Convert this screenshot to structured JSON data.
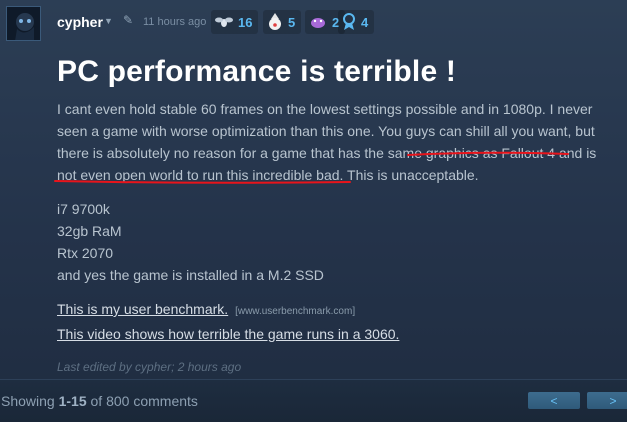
{
  "post": {
    "author": "cypher",
    "timestamp": "11 hours ago",
    "awards": [
      {
        "icon": "fly-icon",
        "count": "16"
      },
      {
        "icon": "clown-icon",
        "count": "5"
      },
      {
        "icon": "purple-crab-icon",
        "count": "2"
      },
      {
        "icon": "ribbon-icon",
        "count": "4"
      }
    ],
    "title": "PC performance is terrible !",
    "paragraph": "I cant even hold stable 60 frames on the lowest settings possible and in 1080p. I never seen a game with worse optimization than this one. You guys can shill all you want, but there is absolutely no reason for a game that has the same graphics as Fallout 4 and is not even open world to run this incredible bad. This is unacceptable.",
    "specs": [
      "i7 9700k",
      "32gb RaM",
      "Rtx 2070",
      "and yes the game is installed in a M.2 SSD"
    ],
    "links": [
      {
        "text": "This is my user benchmark.",
        "host": "[www.userbenchmark.com]"
      },
      {
        "text": "This video shows how terrible the game runs in a 3060."
      }
    ],
    "edited": "Last edited by cypher; 2 hours ago"
  },
  "footer": {
    "showing_prefix": "Showing ",
    "range": "1-15",
    "showing_suffix": " of 800 comments",
    "prev_label": "<",
    "next_label": ">"
  },
  "colors": {
    "accent": "#67c1f5",
    "annotation": "#e8141b"
  }
}
